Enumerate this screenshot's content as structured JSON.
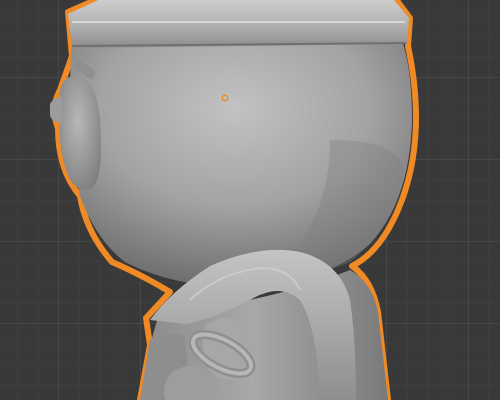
{
  "viewport": {
    "editor": "3D Viewport",
    "object": {
      "selected": true,
      "outline_color": "#f08a24",
      "surface_color": "#9a9a9a",
      "origin_color": "#f08a24"
    },
    "grid_color": "#474747",
    "background_color": "#393939"
  }
}
